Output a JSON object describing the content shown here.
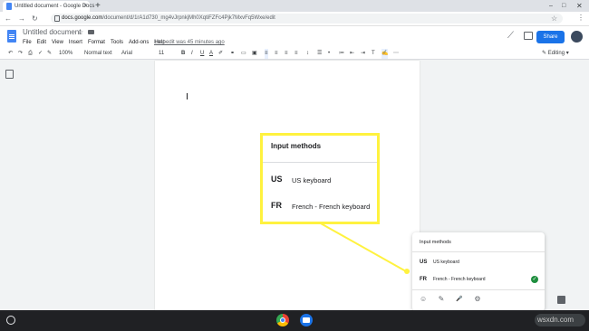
{
  "browser": {
    "tab_title": "Untitled document - Google Docs",
    "tab_close": "×",
    "new_tab": "+",
    "url_host": "docs.google.com",
    "url_path": "/document/d/1rA1d730_mg4vJrpnkjMh0XqtiFZFc4Pjk7MxvFq5Wxe/edit",
    "window_controls": {
      "minimize": "–",
      "maximize": "□",
      "close": "✕"
    },
    "nav": {
      "back": "←",
      "forward": "→",
      "reload": "↻"
    },
    "star": "☆",
    "menu": "⋮"
  },
  "docs": {
    "title": "Untitled document",
    "menu": [
      "File",
      "Edit",
      "View",
      "Insert",
      "Format",
      "Tools",
      "Add-ons",
      "Help"
    ],
    "last_edit": "Last edit was 45 minutes ago",
    "share_label": "Share"
  },
  "format_toolbar": {
    "zoom": "100%",
    "style": "Normal text",
    "font": "Arial",
    "size": "11",
    "mode": "Editing"
  },
  "callout": {
    "title": "Input methods",
    "methods": [
      {
        "code": "US",
        "name": "US keyboard"
      },
      {
        "code": "FR",
        "name": "French - French keyboard"
      }
    ],
    "border_color": "#fff23f"
  },
  "ime_popup": {
    "title": "Input methods",
    "methods": [
      {
        "code": "US",
        "name": "US keyboard"
      },
      {
        "code": "FR",
        "name": "French - French keyboard",
        "selected": true
      }
    ],
    "check": "✓"
  },
  "icons": {
    "emoji": "☺",
    "handwriting": "✎",
    "voice": "🎤",
    "settings": "⚙"
  },
  "watermark": "wsxdn.com",
  "colors": {
    "accent": "#1a73e8",
    "highlight": "#fff23f",
    "check": "#1e8e3e"
  }
}
